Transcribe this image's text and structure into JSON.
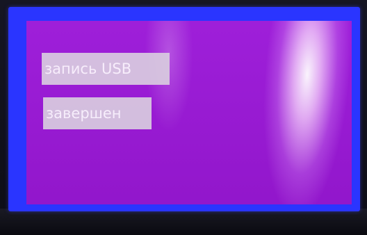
{
  "display": {
    "status_line_1": "запись USB",
    "status_line_2": "завершен"
  },
  "colors": {
    "bezel": "#2a35ff",
    "background": "#9b18d8",
    "text_box": "#d9cce0",
    "text": "#ffffff"
  }
}
